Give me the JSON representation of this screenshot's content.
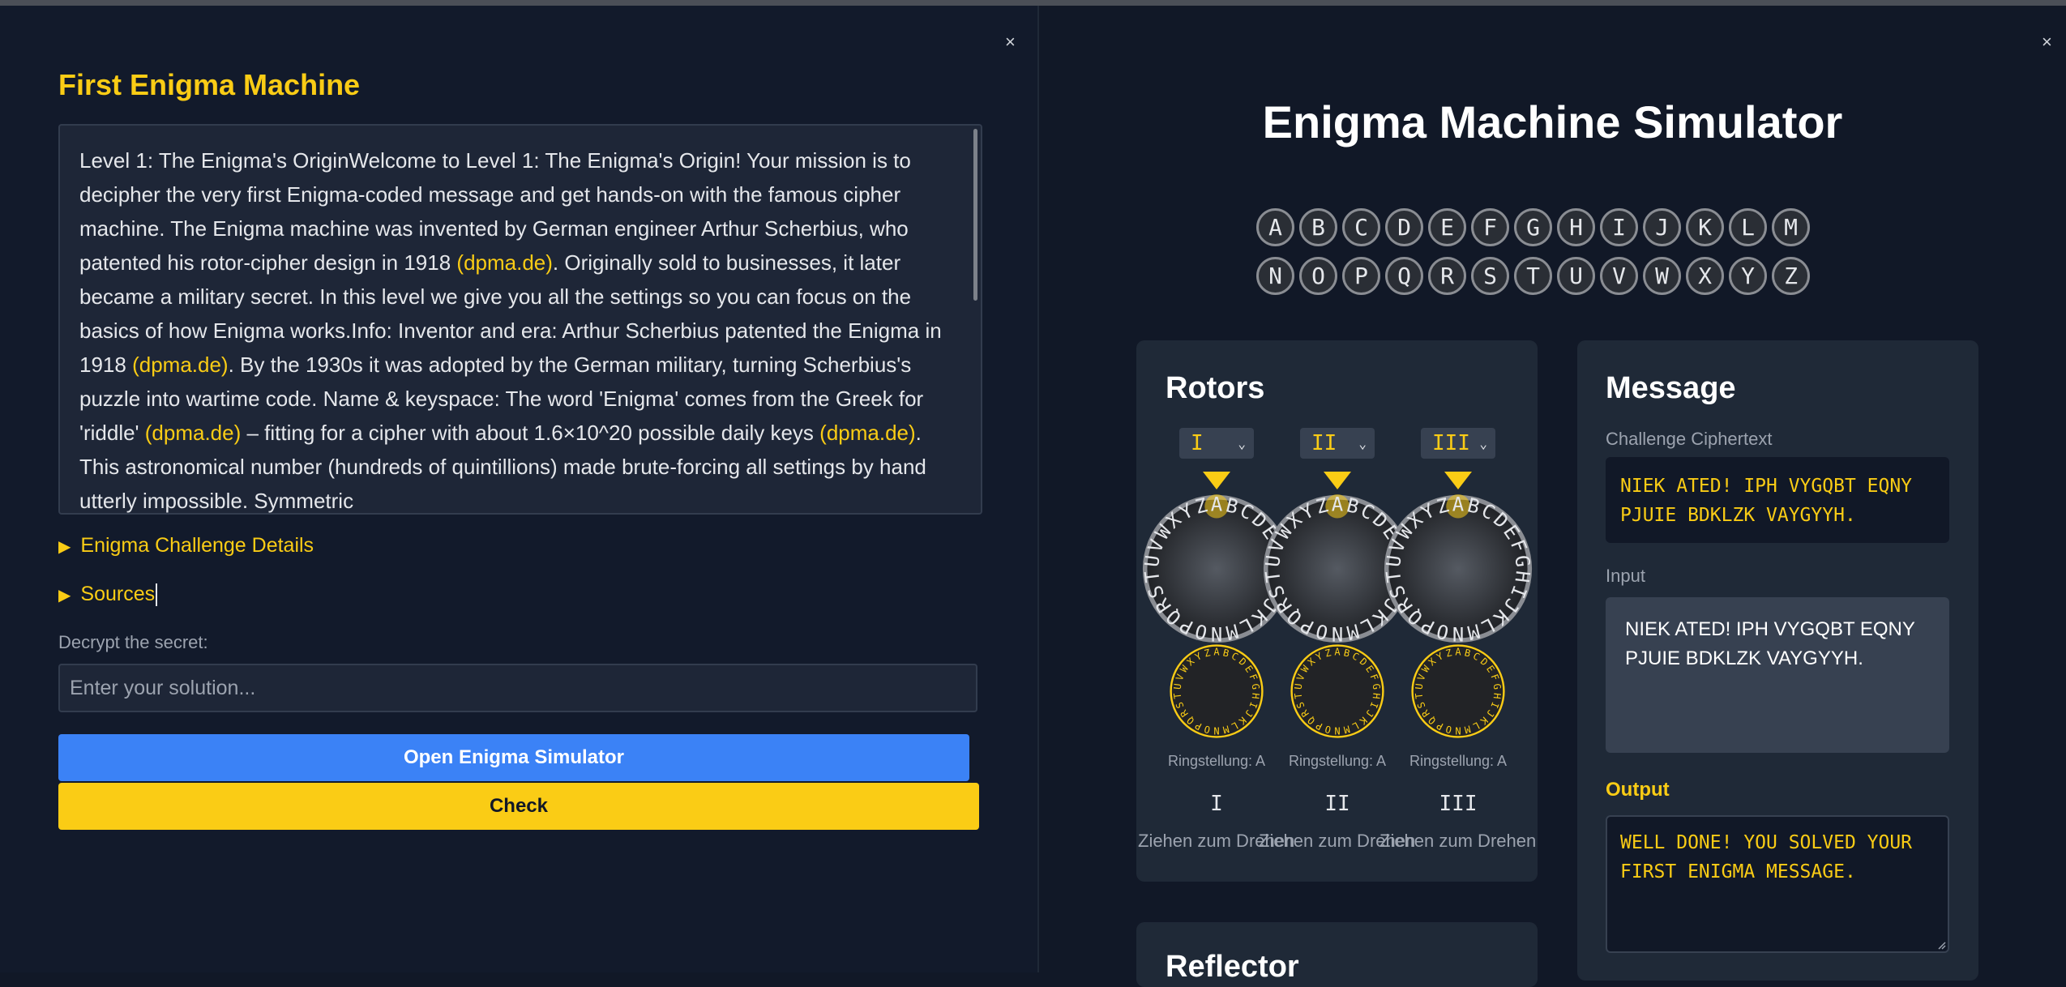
{
  "left_panel": {
    "title": "First Enigma Machine",
    "close": "×",
    "description": [
      {
        "t": "Level 1: The Enigma's OriginWelcome to Level 1: The Enigma's Origin! Your mission is to decipher the very first Enigma-coded message and get hands-on with the famous cipher machine. The Enigma machine was invented by German engineer Arthur Scherbius, who patented his rotor-cipher design in 1918 "
      },
      {
        "t": "(dpma.de)",
        "link": true
      },
      {
        "t": ". Originally sold to businesses, it later became a military secret. In this level we give you all the settings so you can focus on the basics of how Enigma works.Info: Inventor and era: Arthur Scherbius patented the Enigma in 1918 "
      },
      {
        "t": "(dpma.de)",
        "link": true
      },
      {
        "t": ". By the 1930s it was adopted by the German military, turning Scherbius's puzzle into wartime code. Name & keyspace: The word 'Enigma' comes from the Greek for 'riddle' "
      },
      {
        "t": "(dpma.de)",
        "link": true
      },
      {
        "t": " – fitting for a cipher with about 1.6×10^20 possible daily keys "
      },
      {
        "t": "(dpma.de)",
        "link": true
      },
      {
        "t": ". This astronomical number (hundreds of quintillions) made brute-forcing all settings by hand utterly impossible. Symmetric"
      }
    ],
    "details_marker": "▶",
    "details_challenge": "Enigma Challenge Details",
    "details_sources": "Sources",
    "decrypt_label": "Decrypt the secret:",
    "solution_placeholder": "Enter your solution...",
    "open_button": "Open Enigma Simulator",
    "check_button": "Check"
  },
  "simulator": {
    "close": "×",
    "title": "Enigma Machine Simulator",
    "lamps_row1": [
      "A",
      "B",
      "C",
      "D",
      "E",
      "F",
      "G",
      "H",
      "I",
      "J",
      "K",
      "L",
      "M"
    ],
    "lamps_row2": [
      "N",
      "O",
      "P",
      "Q",
      "R",
      "S",
      "T",
      "U",
      "V",
      "W",
      "X",
      "Y",
      "Z"
    ],
    "rotors": {
      "title": "Rotors",
      "items": [
        {
          "select": "I",
          "position": "A",
          "ring": "A",
          "ring_label": "Ringstellung: A",
          "numeral": "I",
          "hint": "Ziehen zum Drehen"
        },
        {
          "select": "II",
          "position": "A",
          "ring": "A",
          "ring_label": "Ringstellung: A",
          "numeral": "II",
          "hint": "Ziehen zum Drehen"
        },
        {
          "select": "III",
          "position": "A",
          "ring": "A",
          "ring_label": "Ringstellung: A",
          "numeral": "III",
          "hint": "Ziehen zum Drehen"
        }
      ]
    },
    "message": {
      "title": "Message",
      "cipher_label": "Challenge Ciphertext",
      "cipher_text": "NIEK ATED! IPH VYGQBT EQNY PJUIE BDKLZK VAYGYYH.",
      "input_label": "Input",
      "input_text": "NIEK ATED! IPH VYGQBT EQNY PJUIE BDKLZK VAYGYYH.",
      "output_label": "Output",
      "output_text": "WELL DONE! YOU SOLVED YOUR FIRST ENIGMA MESSAGE."
    },
    "reflector": {
      "title": "Reflector"
    }
  },
  "colors": {
    "accent": "#facc15",
    "primary_button": "#3b82f6",
    "background": "#111827",
    "card": "#1f2937"
  }
}
